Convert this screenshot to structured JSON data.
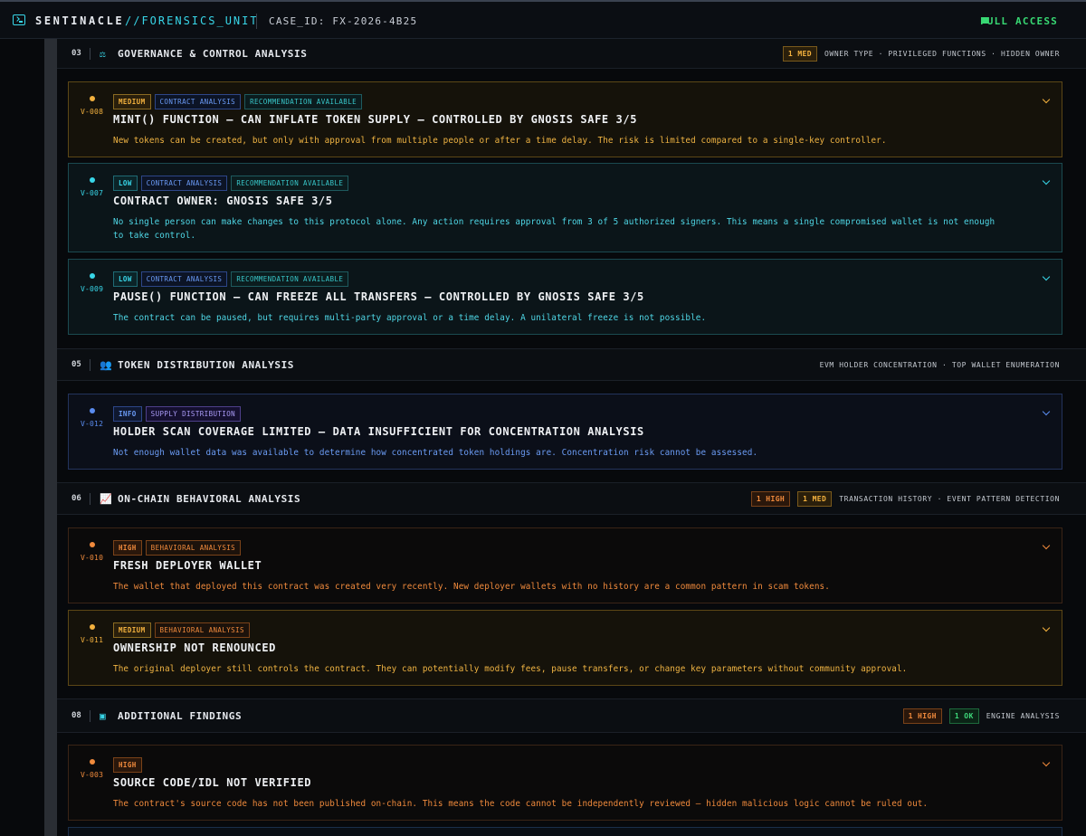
{
  "topbar": {
    "brand": "SENTINACLE",
    "brand_sub": "//FORENSICS_UNIT",
    "case_id": "CASE_ID: FX-2026-4B25",
    "access": "FULL ACCESS"
  },
  "sections": {
    "s03": {
      "num": "03",
      "title": "GOVERNANCE & CONTROL ANALYSIS",
      "counts": [
        "1 MED"
      ],
      "meta": "OWNER TYPE · PRIVILEGED FUNCTIONS · HIDDEN OWNER"
    },
    "s05": {
      "num": "05",
      "title": "TOKEN DISTRIBUTION ANALYSIS",
      "meta": "EVM HOLDER CONCENTRATION · TOP WALLET ENUMERATION"
    },
    "s06": {
      "num": "06",
      "title": "ON-CHAIN BEHAVIORAL ANALYSIS",
      "counts": [
        "1 HIGH",
        "1 MED"
      ],
      "meta": "TRANSACTION HISTORY · EVENT PATTERN DETECTION"
    },
    "s08": {
      "num": "08",
      "title": "ADDITIONAL FINDINGS",
      "counts": [
        "1 HIGH",
        "1 OK"
      ],
      "meta": "ENGINE ANALYSIS"
    }
  },
  "findings": {
    "v008": {
      "id": "V-008",
      "severity": "MEDIUM",
      "tags": [
        "CONTRACT ANALYSIS",
        "RECOMMENDATION AVAILABLE"
      ],
      "title": "MINT() FUNCTION — CAN INFLATE TOKEN SUPPLY — CONTROLLED BY GNOSIS SAFE 3/5",
      "desc": "New tokens can be created, but only with approval from multiple people or after a time delay. The risk is limited compared to a single-key controller."
    },
    "v007": {
      "id": "V-007",
      "severity": "LOW",
      "tags": [
        "CONTRACT ANALYSIS",
        "RECOMMENDATION AVAILABLE"
      ],
      "title": "CONTRACT OWNER: GNOSIS SAFE 3/5",
      "desc": "No single person can make changes to this protocol alone. Any action requires approval from 3 of 5 authorized signers. This means a single compromised wallet is not enough to take control."
    },
    "v009": {
      "id": "V-009",
      "severity": "LOW",
      "tags": [
        "CONTRACT ANALYSIS",
        "RECOMMENDATION AVAILABLE"
      ],
      "title": "PAUSE() FUNCTION — CAN FREEZE ALL TRANSFERS — CONTROLLED BY GNOSIS SAFE 3/5",
      "desc": "The contract can be paused, but requires multi-party approval or a time delay. A unilateral freeze is not possible."
    },
    "v012": {
      "id": "V-012",
      "severity": "INFO",
      "tags": [
        "SUPPLY DISTRIBUTION"
      ],
      "title": "HOLDER SCAN COVERAGE LIMITED — DATA INSUFFICIENT FOR CONCENTRATION ANALYSIS",
      "desc": "Not enough wallet data was available to determine how concentrated token holdings are. Concentration risk cannot be assessed."
    },
    "v010": {
      "id": "V-010",
      "severity": "HIGH",
      "tags": [
        "BEHAVIORAL ANALYSIS"
      ],
      "title": "FRESH DEPLOYER WALLET",
      "desc": "The wallet that deployed this contract was created very recently. New deployer wallets with no history are a common pattern in scam tokens."
    },
    "v011": {
      "id": "V-011",
      "severity": "MEDIUM",
      "tags": [
        "BEHAVIORAL ANALYSIS"
      ],
      "title": "OWNERSHIP NOT RENOUNCED",
      "desc": "The original deployer still controls the contract. They can potentially modify fees, pause transfers, or change key parameters without community approval."
    },
    "v003": {
      "id": "V-003",
      "severity": "HIGH",
      "title": "SOURCE CODE/IDL NOT VERIFIED",
      "desc": "The contract's source code has not been published on-chain. This means the code cannot be independently reviewed — hidden malicious logic cannot be ruled out."
    }
  },
  "icons": {
    "terminal": "terminal-icon",
    "gavel": "gavel-icon",
    "users": "users-icon",
    "trend": "trend-icon",
    "cpu": "cpu-icon",
    "chevron": "chevron-down-icon"
  },
  "colors": {
    "accent": "#38d6e8",
    "access": "#38d873",
    "medium": "#f3b13e",
    "low": "#38d6e8",
    "info": "#5a8cf0",
    "high": "#f08a3c",
    "ok": "#3ed87a"
  }
}
